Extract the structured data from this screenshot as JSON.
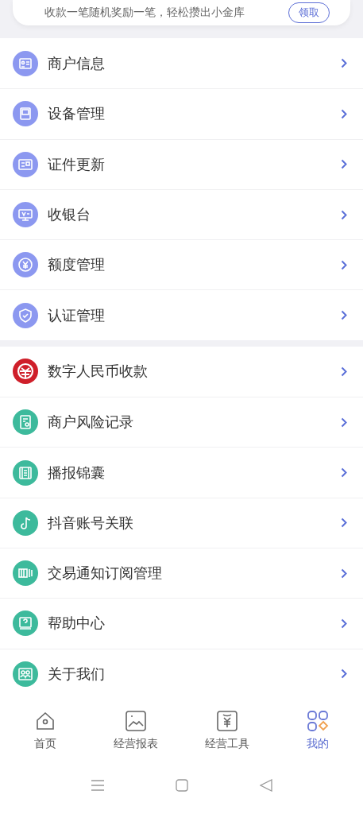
{
  "promo_card": {
    "text": "收款一笔随机奖励一笔，轻松攒出小金库",
    "button": "领取"
  },
  "menu_sections": [
    {
      "items": [
        {
          "label": "商户信息",
          "color": "#8c98f0"
        },
        {
          "label": "设备管理",
          "color": "#8c98f0"
        },
        {
          "label": "证件更新",
          "color": "#8c98f0"
        },
        {
          "label": "收银台",
          "color": "#8c98f0"
        },
        {
          "label": "额度管理",
          "color": "#8c98f0"
        },
        {
          "label": "认证管理",
          "color": "#8c98f0"
        }
      ]
    },
    {
      "items": [
        {
          "label": "数字人民币收款",
          "color": "#cf1f2a"
        },
        {
          "label": "商户风险记录",
          "color": "#3dba9c"
        },
        {
          "label": "播报锦囊",
          "color": "#3dba9c"
        },
        {
          "label": "抖音账号关联",
          "color": "#3dba9c"
        },
        {
          "label": "交易通知订阅管理",
          "color": "#3dba9c"
        },
        {
          "label": "帮助中心",
          "color": "#3dba9c"
        },
        {
          "label": "关于我们",
          "color": "#3dba9c"
        }
      ]
    }
  ],
  "bottom_nav": [
    {
      "label": "首页",
      "selected": false
    },
    {
      "label": "经营报表",
      "selected": false
    },
    {
      "label": "经营工具",
      "selected": false
    },
    {
      "label": "我的",
      "selected": true
    }
  ]
}
